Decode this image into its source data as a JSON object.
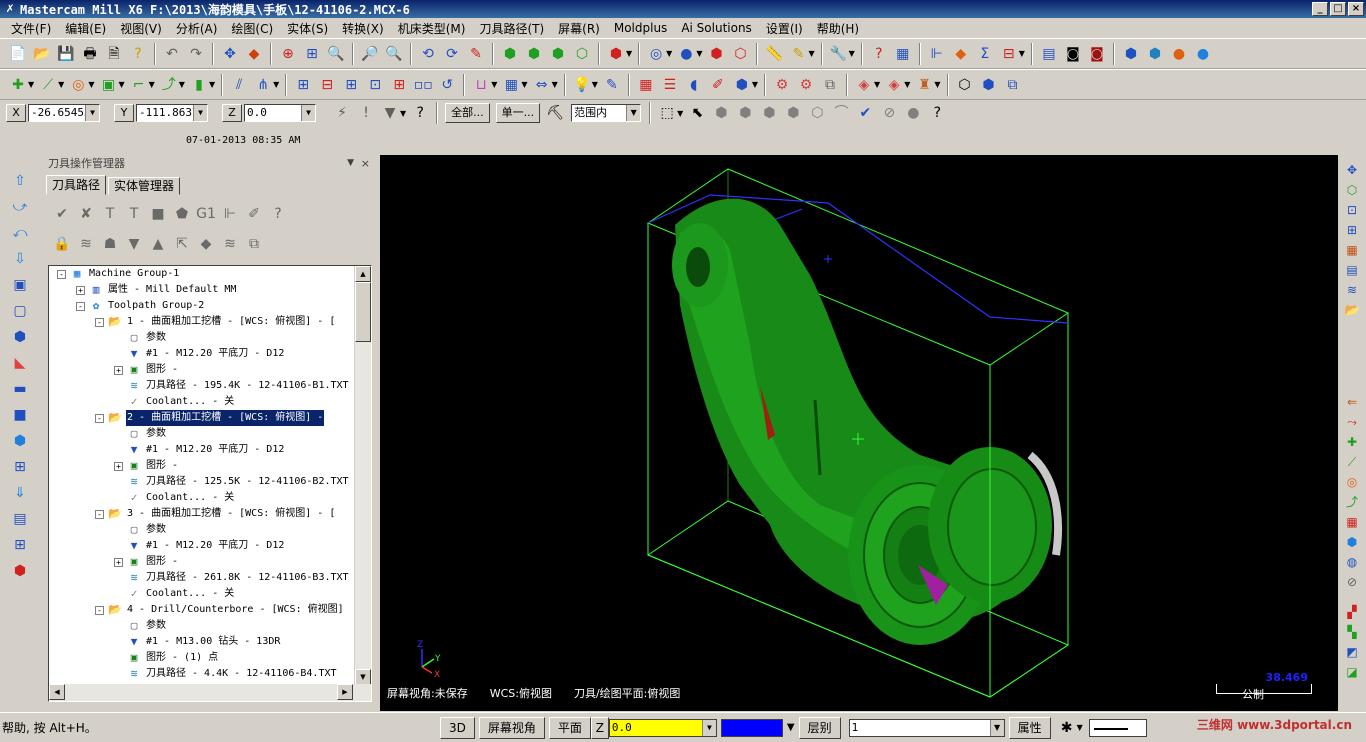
{
  "window": {
    "title": "Mastercam Mill X6  F:\\2013\\海韵模具\\手板\\12-41106-2.MCX-6",
    "buttons": [
      "_",
      "□",
      "×"
    ]
  },
  "menu": [
    "文件(F)",
    "编辑(E)",
    "视图(V)",
    "分析(A)",
    "绘图(C)",
    "实体(S)",
    "转换(X)",
    "机床类型(M)",
    "刀具路径(T)",
    "屏幕(R)",
    "Moldplus",
    "Ai Solutions",
    "设置(I)",
    "帮助(H)"
  ],
  "coords": {
    "x_label": "X",
    "x_value": "-26.65453",
    "y_label": "Y",
    "y_value": "-111.8637",
    "z_label": "Z",
    "z_value": "0.0",
    "all_button": "全部...",
    "single_button": "单一...",
    "range_select": "范围内"
  },
  "datetime": "07-01-2013 08:35 AM",
  "manager": {
    "title": "刀具操作管理器",
    "pin": "▼",
    "close": "×",
    "tabs": [
      "刀具路径",
      "实体管理器"
    ],
    "tree": [
      {
        "level": 0,
        "exp": "-",
        "icon": "machine-group-icon",
        "label": "Machine Group-1"
      },
      {
        "level": 1,
        "exp": "+",
        "icon": "properties-icon",
        "label": "属性 - Mill Default MM"
      },
      {
        "level": 1,
        "exp": "-",
        "icon": "toolpath-group-icon",
        "label": "Toolpath Group-2"
      },
      {
        "level": 2,
        "exp": "-",
        "icon": "folder-icon",
        "label": "1 - 曲面粗加工挖槽 - [WCS: 俯视图] - [",
        "selected": false
      },
      {
        "level": 3,
        "exp": "",
        "icon": "params-icon",
        "label": "参数"
      },
      {
        "level": 3,
        "exp": "",
        "icon": "tool-icon",
        "label": "#1 - M12.20 平底刀 - D12"
      },
      {
        "level": 3,
        "exp": "+",
        "icon": "geometry-icon",
        "label": "图形 -"
      },
      {
        "level": 3,
        "exp": "",
        "icon": "toolpath-icon",
        "label": "刀具路径 - 195.4K - 12-41106-B1.TXT"
      },
      {
        "level": 3,
        "exp": "",
        "icon": "coolant-icon",
        "label": "Coolant... - 关"
      },
      {
        "level": 2,
        "exp": "-",
        "icon": "folder-icon",
        "label": "2 - 曲面粗加工挖槽 - [WCS: 俯视图] -",
        "selected": true
      },
      {
        "level": 3,
        "exp": "",
        "icon": "params-icon",
        "label": "参数"
      },
      {
        "level": 3,
        "exp": "",
        "icon": "tool-icon",
        "label": "#1 - M12.20 平底刀 - D12"
      },
      {
        "level": 3,
        "exp": "+",
        "icon": "geometry-icon",
        "label": "图形 -"
      },
      {
        "level": 3,
        "exp": "",
        "icon": "toolpath-icon",
        "label": "刀具路径 - 125.5K - 12-41106-B2.TXT"
      },
      {
        "level": 3,
        "exp": "",
        "icon": "coolant-icon",
        "label": "Coolant... - 关"
      },
      {
        "level": 2,
        "exp": "-",
        "icon": "folder-icon",
        "label": "3 - 曲面粗加工挖槽 - [WCS: 俯视图] - [",
        "selected": false
      },
      {
        "level": 3,
        "exp": "",
        "icon": "params-icon",
        "label": "参数"
      },
      {
        "level": 3,
        "exp": "",
        "icon": "tool-icon",
        "label": "#1 - M12.20 平底刀 - D12"
      },
      {
        "level": 3,
        "exp": "+",
        "icon": "geometry-icon",
        "label": "图形 -"
      },
      {
        "level": 3,
        "exp": "",
        "icon": "toolpath-icon",
        "label": "刀具路径 - 261.8K - 12-41106-B3.TXT"
      },
      {
        "level": 3,
        "exp": "",
        "icon": "coolant-icon",
        "label": "Coolant... - 关"
      },
      {
        "level": 2,
        "exp": "-",
        "icon": "folder-icon",
        "label": "4 - Drill/Counterbore - [WCS: 俯视图]",
        "selected": false
      },
      {
        "level": 3,
        "exp": "",
        "icon": "params-icon",
        "label": "参数"
      },
      {
        "level": 3,
        "exp": "",
        "icon": "tool-icon",
        "label": "#1 - M13.00 钻头 - 13DR"
      },
      {
        "level": 3,
        "exp": "",
        "icon": "geometry-icon",
        "label": "图形 - (1) 点"
      },
      {
        "level": 3,
        "exp": "",
        "icon": "toolpath-icon",
        "label": "刀具路径 - 4.4K - 12-41106-B4.TXT"
      }
    ]
  },
  "viewport": {
    "status_view": "屏幕视角:未保存",
    "status_wcs": "WCS:俯视图",
    "status_plane": "刀具/绘图平面:俯视图",
    "scale_value": "38.469",
    "scale_unit": "公制",
    "axis_z": "Z",
    "axis_y": "Y",
    "axis_x": "X"
  },
  "statusbar": {
    "help": "帮助, 按 Alt+H。",
    "btn_3d": "3D",
    "btn_view": "屏幕视角",
    "btn_plane": "平面",
    "z_label": "Z",
    "z_value": "0.0",
    "level_label": "层别",
    "level_value": "1",
    "attr_label": "属性",
    "watermark": "三维网 www.3dportal.cn"
  },
  "colors": {
    "titlebar": "#0a246a",
    "selection": "#0a246a",
    "model_green": "#1a8a1a",
    "bbox_line": "#33ff33",
    "toolpath_blue": "#3030ff",
    "z_field": "#ffff00",
    "color_field": "#0000ff"
  }
}
